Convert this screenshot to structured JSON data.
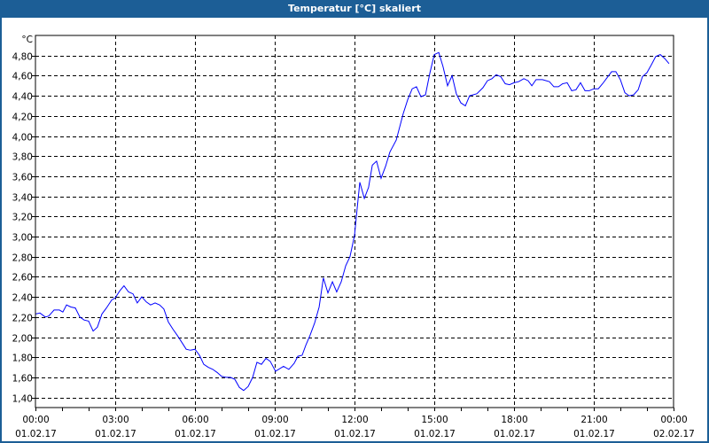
{
  "window": {
    "title": "Temperatur [°C] skaliert"
  },
  "chart_data": {
    "type": "line",
    "title": "Temperatur [°C] skaliert",
    "ylabel": "°C",
    "xlabel": "",
    "ylim": [
      1.3,
      5.0
    ],
    "xlim_hours": [
      0,
      24
    ],
    "grid": true,
    "line_color": "#0000ff",
    "yticks": [
      1.4,
      1.6,
      1.8,
      2.0,
      2.2,
      2.4,
      2.6,
      2.8,
      3.0,
      3.2,
      3.4,
      3.6,
      3.8,
      4.0,
      4.2,
      4.4,
      4.6,
      4.8
    ],
    "ytick_labels": [
      "1,40",
      "1,60",
      "1,80",
      "2,00",
      "2,20",
      "2,40",
      "2,60",
      "2,80",
      "3,00",
      "3,20",
      "3,40",
      "3,60",
      "3,80",
      "4,00",
      "4,20",
      "4,40",
      "4,60",
      "4,80"
    ],
    "xticks_hours": [
      0,
      3,
      6,
      9,
      12,
      15,
      18,
      21,
      24
    ],
    "xtick_times": [
      "00:00",
      "03:00",
      "06:00",
      "09:00",
      "12:00",
      "15:00",
      "18:00",
      "21:00",
      "00:00"
    ],
    "xtick_dates": [
      "01.02.17",
      "01.02.17",
      "01.02.17",
      "01.02.17",
      "01.02.17",
      "01.02.17",
      "01.02.17",
      "01.02.17",
      "02.02.17"
    ],
    "series": [
      {
        "name": "Temperatur",
        "x_hours": [
          0,
          0.17,
          0.37,
          0.5,
          0.7,
          0.9,
          1.03,
          1.17,
          1.33,
          1.5,
          1.67,
          1.83,
          2,
          2.17,
          2.33,
          2.5,
          2.67,
          2.87,
          3,
          3.17,
          3.33,
          3.5,
          3.67,
          3.83,
          4,
          4.17,
          4.33,
          4.5,
          4.67,
          4.83,
          5,
          5.17,
          5.33,
          5.5,
          5.67,
          5.83,
          6,
          6.17,
          6.33,
          6.5,
          6.67,
          6.83,
          7,
          7.17,
          7.33,
          7.5,
          7.67,
          7.83,
          8,
          8.17,
          8.33,
          8.5,
          8.67,
          8.83,
          9.03,
          9.33,
          9.53,
          9.73,
          9.87,
          10.03,
          10.17,
          10.33,
          10.5,
          10.67,
          10.83,
          11,
          11.17,
          11.33,
          11.5,
          11.67,
          11.83,
          12,
          12.1,
          12.2,
          12.37,
          12.53,
          12.67,
          12.83,
          13,
          13.17,
          13.33,
          13.57,
          13.83,
          14,
          14.17,
          14.33,
          14.5,
          14.67,
          14.83,
          15,
          15.17,
          15.33,
          15.5,
          15.67,
          15.83,
          16,
          16.17,
          16.33,
          16.6,
          16.83,
          17,
          17.17,
          17.33,
          17.5,
          17.67,
          17.83,
          18,
          18.17,
          18.37,
          18.53,
          18.67,
          18.83,
          19.07,
          19.33,
          19.5,
          19.67,
          19.83,
          20,
          20.17,
          20.33,
          20.5,
          20.67,
          20.83,
          21,
          21.17,
          21.33,
          21.5,
          21.67,
          21.83,
          22,
          22.17,
          22.33,
          22.5,
          22.67,
          22.83,
          23,
          23.17,
          23.33,
          23.5,
          23.67,
          23.83
        ],
        "values": [
          2.23,
          2.24,
          2.2,
          2.21,
          2.27,
          2.27,
          2.25,
          2.32,
          2.3,
          2.29,
          2.2,
          2.17,
          2.16,
          2.06,
          2.1,
          2.23,
          2.29,
          2.37,
          2.39,
          2.46,
          2.51,
          2.45,
          2.43,
          2.34,
          2.4,
          2.35,
          2.32,
          2.34,
          2.32,
          2.28,
          2.15,
          2.08,
          2.02,
          1.95,
          1.88,
          1.87,
          1.88,
          1.82,
          1.73,
          1.7,
          1.68,
          1.65,
          1.61,
          1.6,
          1.6,
          1.58,
          1.5,
          1.47,
          1.51,
          1.6,
          1.75,
          1.73,
          1.79,
          1.76,
          1.66,
          1.71,
          1.68,
          1.74,
          1.81,
          1.82,
          1.92,
          2.02,
          2.14,
          2.3,
          2.59,
          2.44,
          2.55,
          2.45,
          2.55,
          2.71,
          2.8,
          3.01,
          3.28,
          3.54,
          3.38,
          3.49,
          3.71,
          3.75,
          3.58,
          3.7,
          3.84,
          3.96,
          4.22,
          4.36,
          4.47,
          4.49,
          4.39,
          4.41,
          4.62,
          4.81,
          4.83,
          4.69,
          4.5,
          4.6,
          4.42,
          4.33,
          4.3,
          4.4,
          4.42,
          4.48,
          4.55,
          4.57,
          4.61,
          4.59,
          4.52,
          4.51,
          4.53,
          4.54,
          4.57,
          4.55,
          4.5,
          4.56,
          4.56,
          4.54,
          4.49,
          4.49,
          4.52,
          4.53,
          4.45,
          4.46,
          4.53,
          4.45,
          4.45,
          4.47,
          4.47,
          4.52,
          4.58,
          4.64,
          4.64,
          4.56,
          4.43,
          4.4,
          4.41,
          4.46,
          4.59,
          4.63,
          4.71,
          4.79,
          4.81,
          4.77,
          4.72
        ]
      }
    ]
  }
}
